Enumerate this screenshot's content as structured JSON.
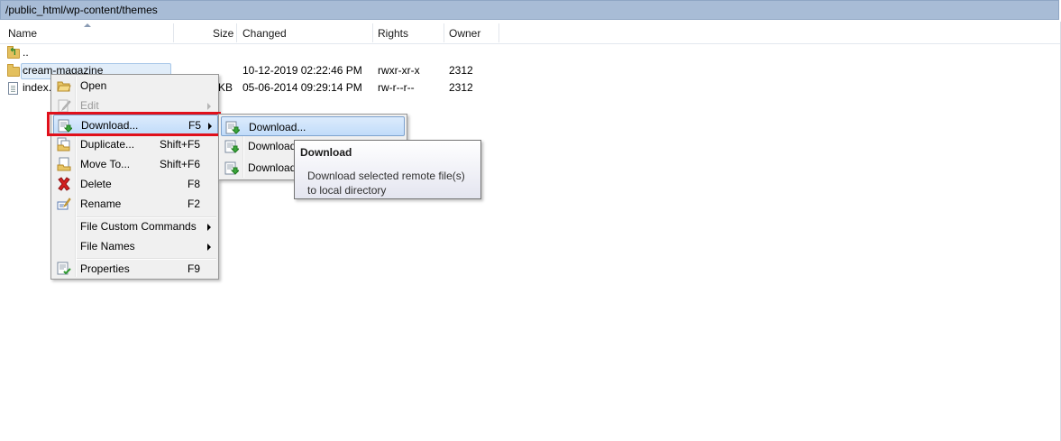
{
  "path": "/public_html/wp-content/themes",
  "columns": [
    "Name",
    "Size",
    "Changed",
    "Rights",
    "Owner"
  ],
  "files": [
    {
      "name": "..",
      "size": "",
      "changed": "",
      "rights": "",
      "owner": "",
      "icon": "parent-folder-icon"
    },
    {
      "name": "cream-magazine",
      "size": "",
      "changed": "10-12-2019 02:22:46 PM",
      "rights": "rwxr-xr-x",
      "owner": "2312",
      "icon": "folder-icon"
    },
    {
      "name": "index.",
      "size": "KB",
      "changed": "05-06-2014 09:29:14 PM",
      "rights": "rw-r--r--",
      "owner": "2312",
      "icon": "file-icon"
    }
  ],
  "context_menu": {
    "items": [
      {
        "label": "Open",
        "shortcut": "",
        "icon": "open-folder-icon"
      },
      {
        "label": "Edit",
        "shortcut": "",
        "icon": "edit-icon",
        "disabled": true
      },
      {
        "label": "Download...",
        "shortcut": "F5",
        "icon": "download-icon",
        "highlighted": true
      },
      {
        "label": "Duplicate...",
        "shortcut": "Shift+F5",
        "icon": "duplicate-icon"
      },
      {
        "label": "Move To...",
        "shortcut": "Shift+F6",
        "icon": "move-icon"
      },
      {
        "label": "Delete",
        "shortcut": "F8",
        "icon": "delete-icon"
      },
      {
        "label": "Rename",
        "shortcut": "F2",
        "icon": "rename-icon"
      },
      {
        "label": "File Custom Commands",
        "shortcut": "",
        "icon": ""
      },
      {
        "label": "File Names",
        "shortcut": "",
        "icon": ""
      },
      {
        "label": "Properties",
        "shortcut": "F9",
        "icon": "properties-icon"
      }
    ]
  },
  "submenu": {
    "items": [
      {
        "label": "Download...",
        "icon": "download-icon"
      },
      {
        "label": "Download",
        "icon": "download-icon"
      },
      {
        "label": "Download",
        "icon": "download-icon"
      }
    ]
  },
  "tooltip": {
    "title": "Download",
    "line1": "Download selected remote file(s)",
    "line2": "to local directory"
  },
  "colors": {
    "highlight_border": "#e0101b",
    "path_bar": "#a8bcd6",
    "selection": "#e1edf9"
  }
}
